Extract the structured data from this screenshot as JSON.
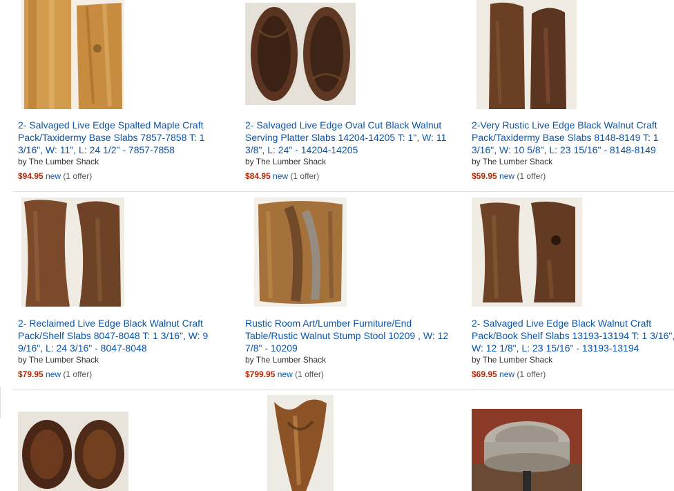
{
  "products": [
    {
      "title": "2- Salvaged Live Edge Spalted Maple Craft Pack/Taxidermy Base Slabs 7857-7858 T: 1 3/16\", W: 11\", L: 24 1/2\" - 7857-7858",
      "seller": "by The Lumber Shack",
      "price": "$94.95",
      "condition": "new",
      "offers": "(1 offer)"
    },
    {
      "title": "2- Salvaged Live Edge Oval Cut Black Walnut Serving Platter Slabs 14204-14205 T: 1\", W: 11 3/8\", L: 24\" - 14204-14205",
      "seller": "by The Lumber Shack",
      "price": "$84.95",
      "condition": "new",
      "offers": "(1 offer)"
    },
    {
      "title": "2-Very Rustic Live Edge Black Walnut Craft Pack/Taxidermy Base Slabs 8148-8149 T: 1 3/16\", W: 10 5/8\", L: 23 15/16\" - 8148-8149",
      "seller": "by The Lumber Shack",
      "price": "$59.95",
      "condition": "new",
      "offers": "(1 offer)"
    },
    {
      "title": "2- Reclaimed Live Edge Black Walnut Craft Pack/Shelf Slabs 8047-8048 T: 1 3/16\", W: 9 9/16\", L: 24 3/16\" - 8047-8048",
      "seller": "by The Lumber Shack",
      "price": "$79.95",
      "condition": "new",
      "offers": "(1 offer)"
    },
    {
      "title": "Rustic Room Art/Lumber Furniture/End Table/Rustic Walnut Stump Stool 10209 , W: 12 7/8\" - 10209",
      "seller": "by The Lumber Shack",
      "price": "$799.95",
      "condition": "new",
      "offers": "(1 offer)"
    },
    {
      "title": "2- Salvaged Live Edge Black Walnut Craft Pack/Book Shelf Slabs 13193-13194 T: 1 3/16\", W: 12 1/8\", L: 23 15/16\" - 13193-13194",
      "seller": "by The Lumber Shack",
      "price": "$69.95",
      "condition": "new",
      "offers": "(1 offer)"
    }
  ],
  "colors": {
    "link": "#0b55a8",
    "price": "#b12704",
    "maple": "#c98a3c",
    "walnut": "#5a3420"
  }
}
